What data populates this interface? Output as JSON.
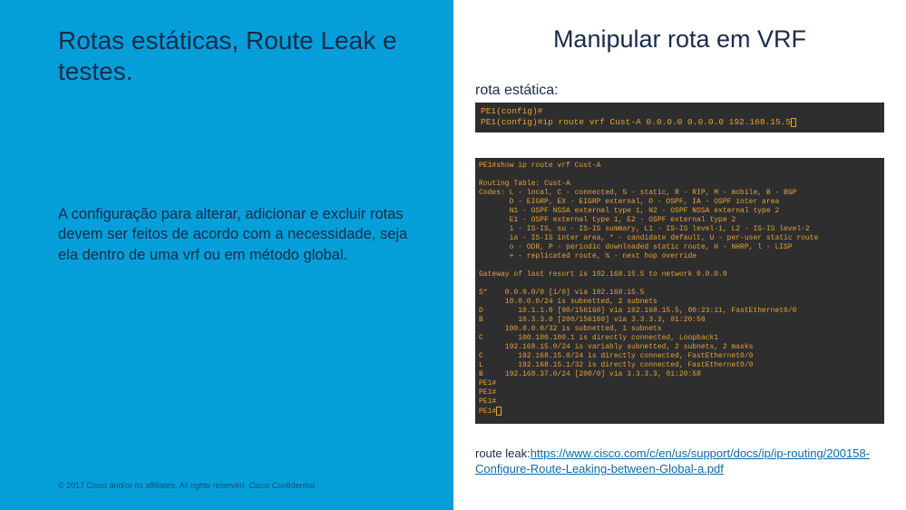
{
  "left": {
    "title": "Rotas estáticas, Route Leak e testes.",
    "body": "A configuração para alterar, adicionar e excluir rotas devem ser feitos de acordo com a necessidade, seja ela dentro de uma vrf ou em método global.",
    "footer": "© 2017  Cisco and/or its affiliates. All rights reserved.   Cisco Confidential"
  },
  "right": {
    "title": "Manipular rota em VRF",
    "static_label": "rota estática:",
    "terminal1_line1": "PE1(config)#",
    "terminal1_line2": "PE1(config)#ip route vrf Cust-A 0.0.0.0 0.0.0.0 192.168.15.5",
    "terminal2": "PE1#show ip route vrf Cust-A\n\nRouting Table: Cust-A\nCodes: L - local, C - connected, S - static, R - RIP, M - mobile, B - BGP\n       D - EIGRP, EX - EIGRP external, O - OSPF, IA - OSPF inter area\n       N1 - OSPF NSSA external type 1, N2 - OSPF NSSA external type 2\n       E1 - OSPF external type 1, E2 - OSPF external type 2\n       i - IS-IS, su - IS-IS summary, L1 - IS-IS level-1, L2 - IS-IS level-2\n       ia - IS-IS inter area, * - candidate default, U - per-user static route\n       o - ODR, P - periodic downloaded static route, H - NHRP, l - LISP\n       + - replicated route, % - next hop override\n\nGateway of last resort is 192.168.15.5 to network 0.0.0.0\n\nS*    0.0.0.0/0 [1/0] via 192.168.15.5\n      10.0.0.0/24 is subnetted, 2 subnets\nD        10.1.1.0 [90/156160] via 192.168.15.5, 00:23:11, FastEthernet0/0\nB        10.3.3.0 [200/156160] via 3.3.3.3, 01:20:58\n      100.0.0.0/32 is subnetted, 1 subnets\nC        100.100.100.1 is directly connected, Loopback1\n      192.168.15.0/24 is variably subnetted, 2 subnets, 2 masks\nC        192.168.15.0/24 is directly connected, FastEthernet0/0\nL        192.168.15.1/32 is directly connected, FastEthernet0/0\nB     192.168.37.0/24 [200/0] via 3.3.3.3, 01:20:58\nPE1#\nPE1#\nPE1#\nPE1#",
    "route_leak_label": "route leak:",
    "route_leak_url": "https://www.cisco.com/c/en/us/support/docs/ip/ip-routing/200158-Configure-Route-Leaking-between-Global-a.pdf"
  }
}
